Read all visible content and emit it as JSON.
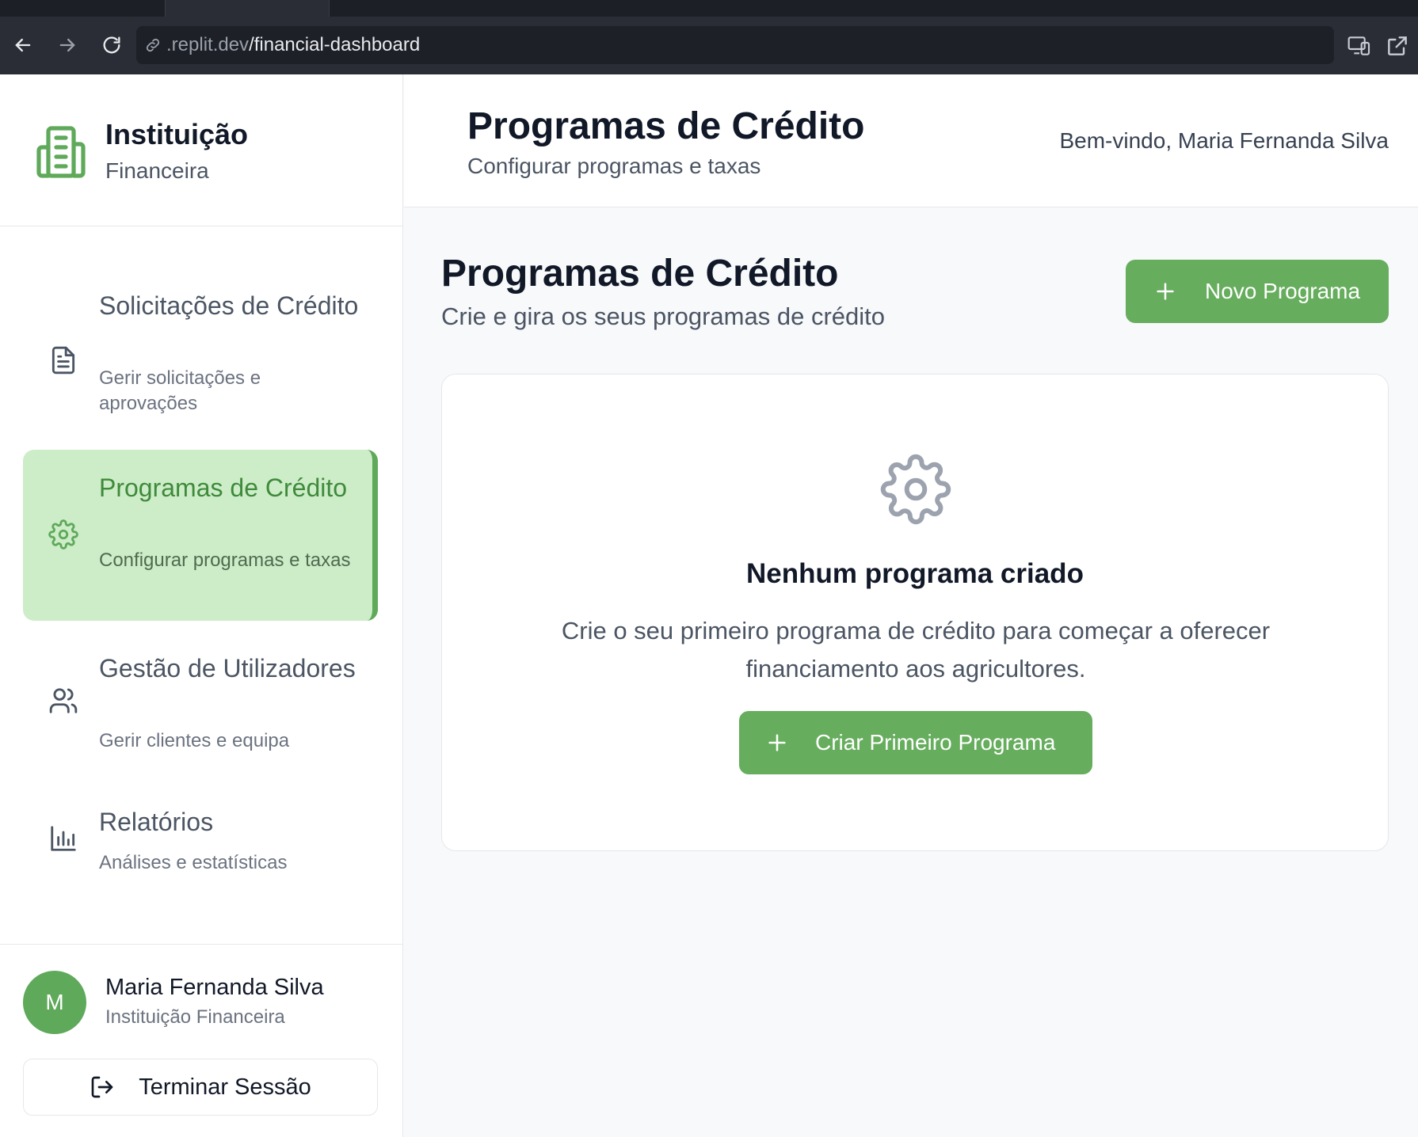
{
  "browser": {
    "url_prefix": ".replit.dev",
    "url_path": "/financial-dashboard"
  },
  "sidebar": {
    "brand_title": "Instituição",
    "brand_subtitle": "Financeira",
    "items": [
      {
        "label": "Solicitações de Crédito",
        "description": "Gerir solicitações e aprovações",
        "icon": "file-text-icon",
        "active": false
      },
      {
        "label": "Programas de Crédito",
        "description": "Configurar programas e taxas",
        "icon": "gear-icon",
        "active": true
      },
      {
        "label": "Gestão de Utilizadores",
        "description": "Gerir clientes e equipa",
        "icon": "users-icon",
        "active": false
      },
      {
        "label": "Relatórios",
        "description": "Análises e estatísticas",
        "icon": "bar-chart-icon",
        "active": false
      }
    ],
    "user": {
      "initial": "M",
      "name": "Maria Fernanda Silva",
      "role": "Instituição Financeira"
    },
    "logout_label": "Terminar Sessão"
  },
  "header": {
    "title": "Programas de Crédito",
    "subtitle": "Configurar programas e taxas",
    "welcome": "Bem-vindo, Maria Fernanda Silva"
  },
  "main": {
    "title": "Programas de Crédito",
    "subtitle": "Crie e gira os seus programas de crédito",
    "new_button": "Novo Programa",
    "empty_state": {
      "title": "Nenhum programa criado",
      "text": "Crie o seu primeiro programa de crédito para começar a oferecer financiamento aos agricultores.",
      "button": "Criar Primeiro Programa"
    }
  },
  "colors": {
    "accent": "#66ad5d",
    "active_bg": "#cdedc9",
    "active_text": "#3f8a3b"
  }
}
